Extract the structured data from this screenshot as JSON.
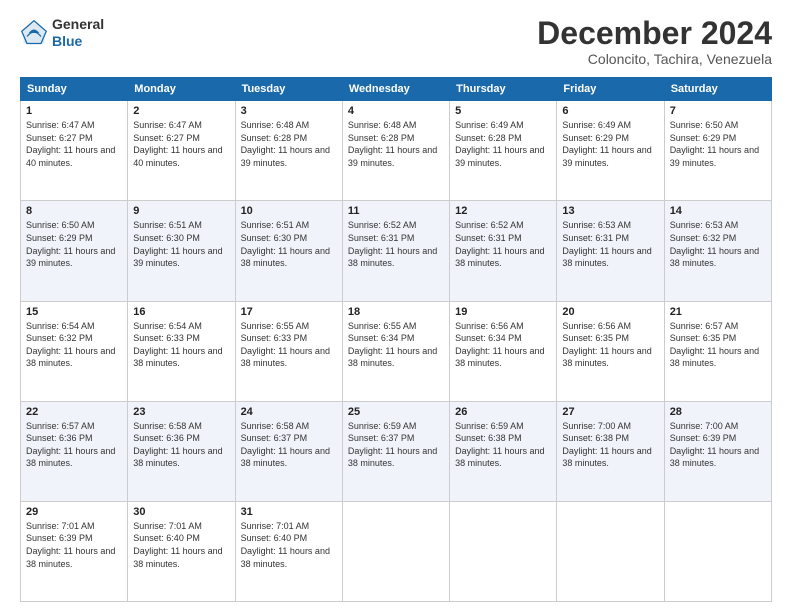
{
  "logo": {
    "general": "General",
    "blue": "Blue"
  },
  "title": "December 2024",
  "location": "Coloncito, Tachira, Venezuela",
  "days_of_week": [
    "Sunday",
    "Monday",
    "Tuesday",
    "Wednesday",
    "Thursday",
    "Friday",
    "Saturday"
  ],
  "weeks": [
    [
      {
        "day": "1",
        "sunrise": "Sunrise: 6:47 AM",
        "sunset": "Sunset: 6:27 PM",
        "daylight": "Daylight: 11 hours and 40 minutes."
      },
      {
        "day": "2",
        "sunrise": "Sunrise: 6:47 AM",
        "sunset": "Sunset: 6:27 PM",
        "daylight": "Daylight: 11 hours and 40 minutes."
      },
      {
        "day": "3",
        "sunrise": "Sunrise: 6:48 AM",
        "sunset": "Sunset: 6:28 PM",
        "daylight": "Daylight: 11 hours and 39 minutes."
      },
      {
        "day": "4",
        "sunrise": "Sunrise: 6:48 AM",
        "sunset": "Sunset: 6:28 PM",
        "daylight": "Daylight: 11 hours and 39 minutes."
      },
      {
        "day": "5",
        "sunrise": "Sunrise: 6:49 AM",
        "sunset": "Sunset: 6:28 PM",
        "daylight": "Daylight: 11 hours and 39 minutes."
      },
      {
        "day": "6",
        "sunrise": "Sunrise: 6:49 AM",
        "sunset": "Sunset: 6:29 PM",
        "daylight": "Daylight: 11 hours and 39 minutes."
      },
      {
        "day": "7",
        "sunrise": "Sunrise: 6:50 AM",
        "sunset": "Sunset: 6:29 PM",
        "daylight": "Daylight: 11 hours and 39 minutes."
      }
    ],
    [
      {
        "day": "8",
        "sunrise": "Sunrise: 6:50 AM",
        "sunset": "Sunset: 6:29 PM",
        "daylight": "Daylight: 11 hours and 39 minutes."
      },
      {
        "day": "9",
        "sunrise": "Sunrise: 6:51 AM",
        "sunset": "Sunset: 6:30 PM",
        "daylight": "Daylight: 11 hours and 39 minutes."
      },
      {
        "day": "10",
        "sunrise": "Sunrise: 6:51 AM",
        "sunset": "Sunset: 6:30 PM",
        "daylight": "Daylight: 11 hours and 38 minutes."
      },
      {
        "day": "11",
        "sunrise": "Sunrise: 6:52 AM",
        "sunset": "Sunset: 6:31 PM",
        "daylight": "Daylight: 11 hours and 38 minutes."
      },
      {
        "day": "12",
        "sunrise": "Sunrise: 6:52 AM",
        "sunset": "Sunset: 6:31 PM",
        "daylight": "Daylight: 11 hours and 38 minutes."
      },
      {
        "day": "13",
        "sunrise": "Sunrise: 6:53 AM",
        "sunset": "Sunset: 6:31 PM",
        "daylight": "Daylight: 11 hours and 38 minutes."
      },
      {
        "day": "14",
        "sunrise": "Sunrise: 6:53 AM",
        "sunset": "Sunset: 6:32 PM",
        "daylight": "Daylight: 11 hours and 38 minutes."
      }
    ],
    [
      {
        "day": "15",
        "sunrise": "Sunrise: 6:54 AM",
        "sunset": "Sunset: 6:32 PM",
        "daylight": "Daylight: 11 hours and 38 minutes."
      },
      {
        "day": "16",
        "sunrise": "Sunrise: 6:54 AM",
        "sunset": "Sunset: 6:33 PM",
        "daylight": "Daylight: 11 hours and 38 minutes."
      },
      {
        "day": "17",
        "sunrise": "Sunrise: 6:55 AM",
        "sunset": "Sunset: 6:33 PM",
        "daylight": "Daylight: 11 hours and 38 minutes."
      },
      {
        "day": "18",
        "sunrise": "Sunrise: 6:55 AM",
        "sunset": "Sunset: 6:34 PM",
        "daylight": "Daylight: 11 hours and 38 minutes."
      },
      {
        "day": "19",
        "sunrise": "Sunrise: 6:56 AM",
        "sunset": "Sunset: 6:34 PM",
        "daylight": "Daylight: 11 hours and 38 minutes."
      },
      {
        "day": "20",
        "sunrise": "Sunrise: 6:56 AM",
        "sunset": "Sunset: 6:35 PM",
        "daylight": "Daylight: 11 hours and 38 minutes."
      },
      {
        "day": "21",
        "sunrise": "Sunrise: 6:57 AM",
        "sunset": "Sunset: 6:35 PM",
        "daylight": "Daylight: 11 hours and 38 minutes."
      }
    ],
    [
      {
        "day": "22",
        "sunrise": "Sunrise: 6:57 AM",
        "sunset": "Sunset: 6:36 PM",
        "daylight": "Daylight: 11 hours and 38 minutes."
      },
      {
        "day": "23",
        "sunrise": "Sunrise: 6:58 AM",
        "sunset": "Sunset: 6:36 PM",
        "daylight": "Daylight: 11 hours and 38 minutes."
      },
      {
        "day": "24",
        "sunrise": "Sunrise: 6:58 AM",
        "sunset": "Sunset: 6:37 PM",
        "daylight": "Daylight: 11 hours and 38 minutes."
      },
      {
        "day": "25",
        "sunrise": "Sunrise: 6:59 AM",
        "sunset": "Sunset: 6:37 PM",
        "daylight": "Daylight: 11 hours and 38 minutes."
      },
      {
        "day": "26",
        "sunrise": "Sunrise: 6:59 AM",
        "sunset": "Sunset: 6:38 PM",
        "daylight": "Daylight: 11 hours and 38 minutes."
      },
      {
        "day": "27",
        "sunrise": "Sunrise: 7:00 AM",
        "sunset": "Sunset: 6:38 PM",
        "daylight": "Daylight: 11 hours and 38 minutes."
      },
      {
        "day": "28",
        "sunrise": "Sunrise: 7:00 AM",
        "sunset": "Sunset: 6:39 PM",
        "daylight": "Daylight: 11 hours and 38 minutes."
      }
    ],
    [
      {
        "day": "29",
        "sunrise": "Sunrise: 7:01 AM",
        "sunset": "Sunset: 6:39 PM",
        "daylight": "Daylight: 11 hours and 38 minutes."
      },
      {
        "day": "30",
        "sunrise": "Sunrise: 7:01 AM",
        "sunset": "Sunset: 6:40 PM",
        "daylight": "Daylight: 11 hours and 38 minutes."
      },
      {
        "day": "31",
        "sunrise": "Sunrise: 7:01 AM",
        "sunset": "Sunset: 6:40 PM",
        "daylight": "Daylight: 11 hours and 38 minutes."
      },
      null,
      null,
      null,
      null
    ]
  ]
}
